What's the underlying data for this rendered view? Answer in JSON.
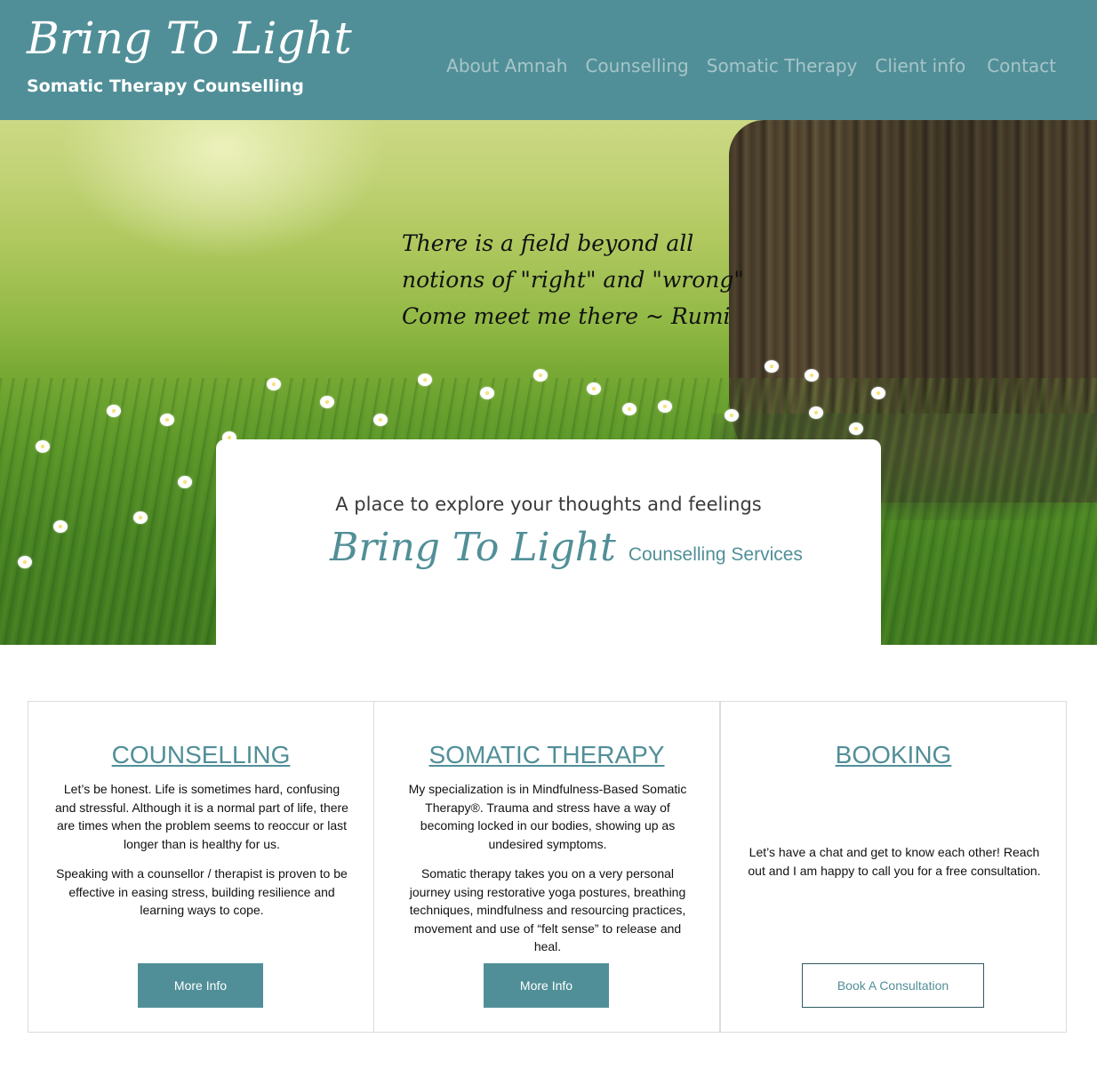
{
  "header": {
    "logo_script": "Bring To Light",
    "logo_sub": "Somatic Therapy Counselling",
    "nav": [
      "About Amnah",
      "Counselling",
      "Somatic Therapy",
      "Client info",
      "Contact"
    ]
  },
  "hero": {
    "quote_lines": [
      "There is a field beyond all",
      "notions of \"right\" and \"wrong\"",
      "Come meet me there ~ Rumi"
    ]
  },
  "intro_card": {
    "tagline": "A place to explore your thoughts and feelings",
    "brand_script": "Bring To Light",
    "brand_suffix": "Counselling Services"
  },
  "services": [
    {
      "title": "COUNSELLING",
      "paragraphs": [
        "Let’s be honest. Life is sometimes hard, confusing and stressful. Although it is a normal part of life, there are times when the problem seems to reoccur or last longer than is healthy for us.",
        "Speaking with a counsellor / therapist is proven to be effective in easing stress, building resilience and learning ways to cope."
      ],
      "button": "More Info"
    },
    {
      "title": "SOMATIC THERAPY",
      "paragraphs": [
        "My specialization is in Mindfulness-Based Somatic Therapy®. Trauma and stress have a way of becoming locked in our bodies, showing up as undesired symptoms.",
        "Somatic therapy takes you on a very personal journey using restorative yoga postures, breathing techniques, mindfulness and resourcing practices, movement and use of “felt sense” to release and heal."
      ],
      "button": "More Info"
    },
    {
      "title": "BOOKING",
      "paragraphs": [
        "Let’s have a chat and get to know each other! Reach out and I am happy to call you for a free consultation."
      ],
      "button": "Book A Consultation"
    }
  ],
  "colors": {
    "brand_teal": "#518f98",
    "nav_text": "#a7c5c9"
  }
}
